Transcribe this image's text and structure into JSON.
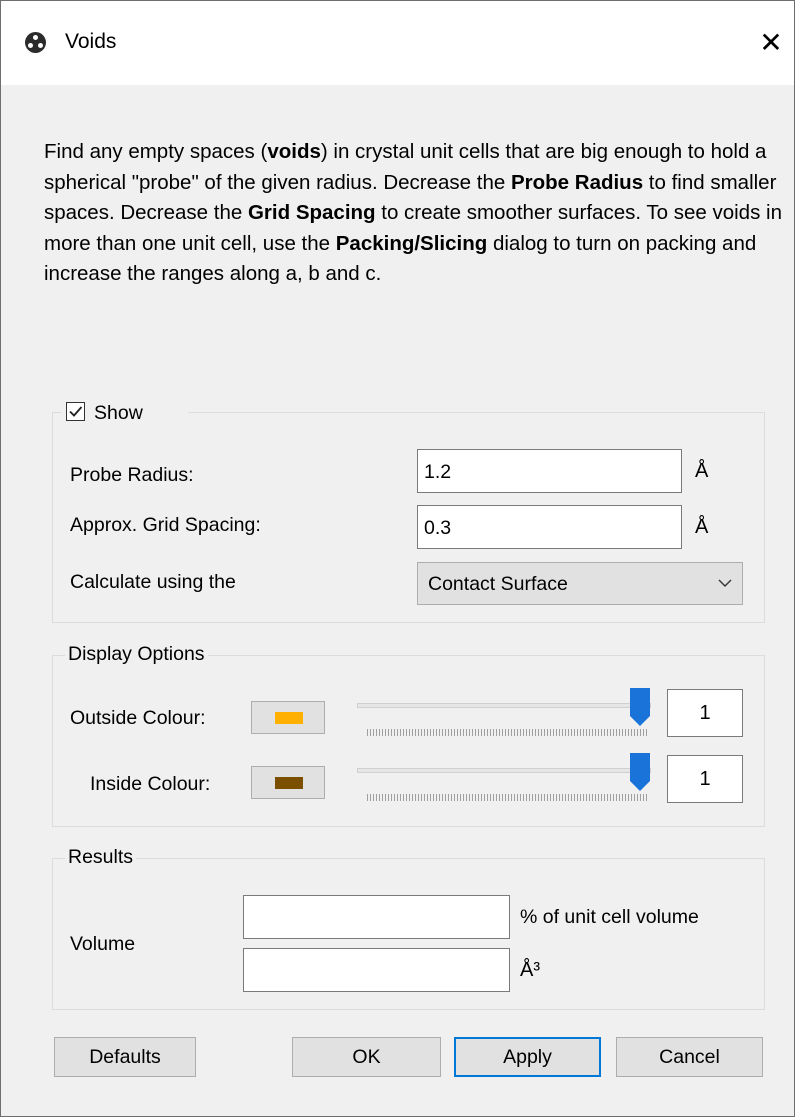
{
  "window": {
    "title": "Voids",
    "close_glyph": "✕",
    "icon": "voids-app-icon"
  },
  "description": {
    "p1": "Find any empty spaces (",
    "b1": "voids",
    "p2": ") in crystal unit cells that are big enough to hold a spherical \"probe\" of the given radius. Decrease the ",
    "b2": "Probe Radius",
    "p3": " to find smaller spaces. Decrease the ",
    "b3": "Grid Spacing",
    "p4": " to create smoother surfaces. To see voids in more than one unit cell, use the ",
    "b4": "Packing/Slicing",
    "p5": " dialog to turn on packing and increase the ranges along a, b and c."
  },
  "show_group": {
    "checkbox_label": "Show",
    "checked": true,
    "probe_radius_label": "Probe Radius:",
    "probe_radius_value": "1.2",
    "probe_radius_unit": "Å",
    "grid_spacing_label": "Approx. Grid Spacing:",
    "grid_spacing_value": "0.3",
    "grid_spacing_unit": "Å",
    "calculate_label": "Calculate using the",
    "calculate_value": "Contact Surface"
  },
  "display_group": {
    "title": "Display Options",
    "outside_label": "Outside Colour:",
    "outside_color": "#ffb000",
    "outside_opacity_value": "1",
    "outside_slider_fraction": 1.0,
    "inside_label": "Inside Colour:",
    "inside_color": "#7a4f00",
    "inside_opacity_value": "1",
    "inside_slider_fraction": 1.0
  },
  "results_group": {
    "title": "Results",
    "volume_label": "Volume",
    "percent_value": "",
    "percent_unit": "% of unit cell volume",
    "volume_value": "",
    "volume_unit": "Å³"
  },
  "buttons": {
    "defaults": "Defaults",
    "ok": "OK",
    "apply": "Apply",
    "cancel": "Cancel"
  },
  "colors": {
    "accent": "#0078d7",
    "slider_thumb": "#1a73d9"
  }
}
